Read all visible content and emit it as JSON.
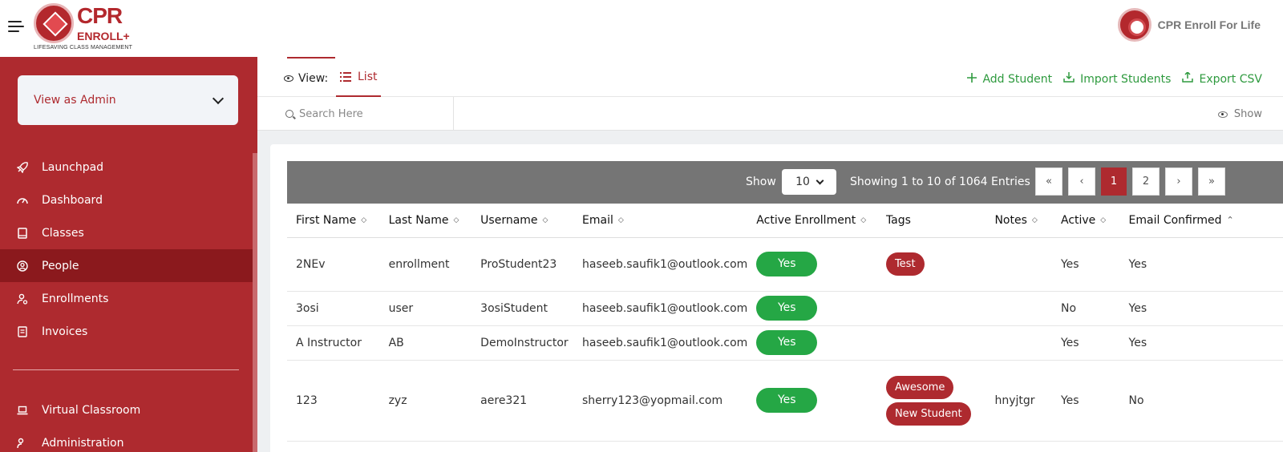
{
  "brand": {
    "logo_cpr": "CPR",
    "logo_enroll": "ENROLL+",
    "logo_tagline": "LIFESAVING CLASS MANAGEMENT",
    "org_name": "CPR Enroll For Life",
    "accent": "#ae2a2f",
    "active_nav": "#8b191d",
    "success": "#25a745"
  },
  "sidebar": {
    "role_select": "View as Admin",
    "items": [
      {
        "label": "Launchpad",
        "icon": "rocket-icon"
      },
      {
        "label": "Dashboard",
        "icon": "gauge-icon"
      },
      {
        "label": "Classes",
        "icon": "book-icon"
      },
      {
        "label": "People",
        "icon": "person-circle-icon",
        "active": true
      },
      {
        "label": "Enrollments",
        "icon": "user-check-icon"
      },
      {
        "label": "Invoices",
        "icon": "receipt-icon"
      }
    ],
    "items2": [
      {
        "label": "Virtual Classroom",
        "icon": "laptop-icon"
      },
      {
        "label": "Administration",
        "icon": "admin-icon"
      }
    ]
  },
  "toolbar": {
    "view_label": "View:",
    "list_tab": "List",
    "add_student": "Add Student",
    "import_students": "Import Students",
    "export_csv": "Export CSV"
  },
  "search": {
    "placeholder": "Search Here",
    "show_label": "Show"
  },
  "pager": {
    "show_label": "Show",
    "page_size": "10",
    "info": "Showing 1 to 10 of 1064 Entries",
    "first": "«",
    "prev": "‹",
    "pages": [
      "1",
      "2"
    ],
    "next": "›",
    "last": "»"
  },
  "table": {
    "headers": [
      "First Name",
      "Last Name",
      "Username",
      "Email",
      "Active Enrollment",
      "Tags",
      "Notes",
      "Active",
      "Email Confirmed"
    ],
    "rows": [
      {
        "first": "2NEv",
        "last": "enrollment",
        "username": "ProStudent23",
        "email": "haseeb.saufik1@outlook.com",
        "enrollment": "Yes",
        "tags": [
          "Test"
        ],
        "notes": "",
        "active": "Yes",
        "confirmed": "Yes"
      },
      {
        "first": "3osi",
        "last": "user",
        "username": "3osiStudent",
        "email": "haseeb.saufik1@outlook.com",
        "enrollment": "Yes",
        "tags": [],
        "notes": "",
        "active": "No",
        "confirmed": "Yes"
      },
      {
        "first": "A Instructor",
        "last": "AB",
        "username": "DemoInstructor",
        "email": "haseeb.saufik1@outlook.com",
        "enrollment": "Yes",
        "tags": [],
        "notes": "",
        "active": "Yes",
        "confirmed": "Yes"
      },
      {
        "first": "123",
        "last": "zyz",
        "username": "aere321",
        "email": "sherry123@yopmail.com",
        "enrollment": "Yes",
        "tags": [
          "Awesome",
          "New Student"
        ],
        "notes": "hnyjtgr",
        "active": "Yes",
        "confirmed": "No"
      }
    ]
  }
}
